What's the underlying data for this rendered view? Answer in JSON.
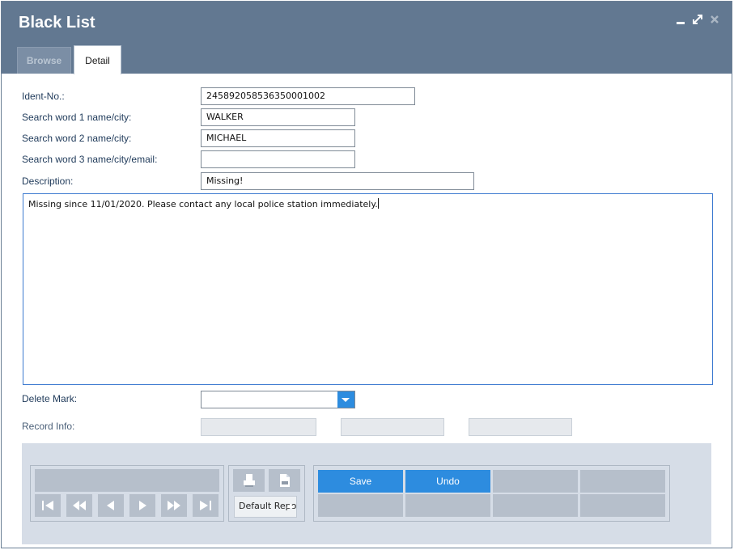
{
  "window": {
    "title": "Black List"
  },
  "tabs": [
    {
      "label": "Browse",
      "active": false
    },
    {
      "label": "Detail",
      "active": true
    }
  ],
  "form": {
    "ident_label": "Ident-No.:",
    "ident_value": "245892058536350001002",
    "search1_label": "Search word 1 name/city:",
    "search1_value": "WALKER",
    "search2_label": "Search word 2 name/city:",
    "search2_value": "MICHAEL",
    "search3_label": "Search word 3 name/city/email:",
    "search3_value": "",
    "description_label": "Description:",
    "description_value": "Missing!",
    "notes_value": "Missing since 11/01/2020. Please contact any local police station immediately.",
    "delete_mark_label": "Delete Mark:",
    "delete_mark_value": "",
    "record_info_label": "Record Info:"
  },
  "toolbar": {
    "report_value": "Default Report",
    "save_label": "Save",
    "undo_label": "Undo"
  },
  "colors": {
    "titlebar": "#627891",
    "accent": "#2d8cdf",
    "panel": "#d6dde7"
  },
  "icons": [
    "minimize-icon",
    "maximize-icon",
    "close-icon",
    "dropdown-arrow-icon",
    "first-record-icon",
    "rewind-icon",
    "previous-icon",
    "next-icon",
    "fast-forward-icon",
    "last-record-icon",
    "print-icon",
    "pdf-export-icon"
  ]
}
